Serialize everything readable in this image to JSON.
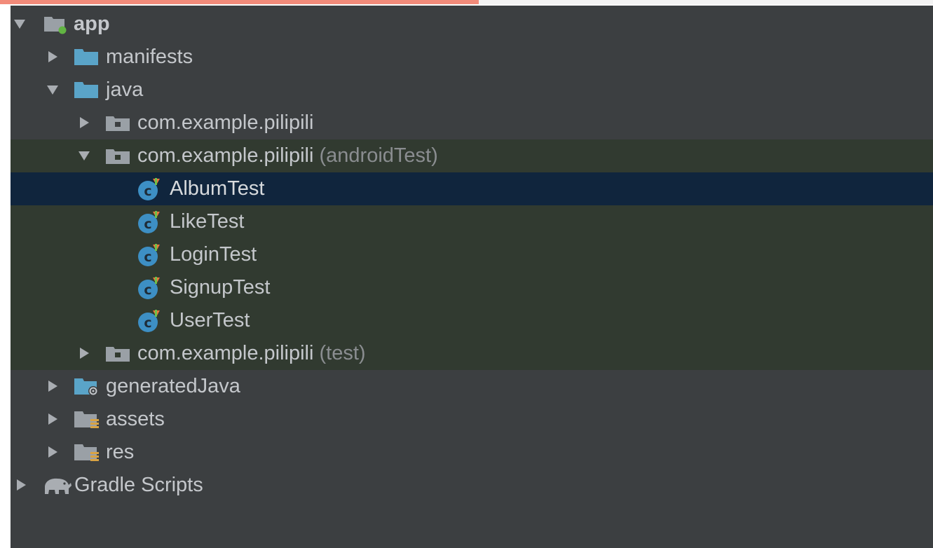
{
  "colors": {
    "panel_bg": "#3c3f41",
    "test_source_bg": "#313a30",
    "selection_bg": "#10253d",
    "text": "#c4c7cb",
    "secondary_text": "#8a8d90",
    "folder_blue": "#5aa4c8",
    "folder_gray": "#9aa0a6",
    "accent_orange": "#f28b7a"
  },
  "tree": {
    "app": {
      "label": "app",
      "icon": "module-folder-icon",
      "expanded": true
    },
    "manifests": {
      "label": "manifests",
      "icon": "folder-icon",
      "expanded": false
    },
    "java": {
      "label": "java",
      "icon": "folder-icon",
      "expanded": true
    },
    "pkg_main": {
      "label": "com.example.pilipili",
      "suffix": "",
      "icon": "package-icon",
      "expanded": false
    },
    "pkg_android_test": {
      "label": "com.example.pilipili",
      "suffix": "(androidTest)",
      "icon": "package-icon",
      "expanded": true
    },
    "classes": [
      {
        "label": "AlbumTest",
        "icon": "test-class-icon",
        "selected": true
      },
      {
        "label": "LikeTest",
        "icon": "test-class-icon",
        "selected": false
      },
      {
        "label": "LoginTest",
        "icon": "test-class-icon",
        "selected": false
      },
      {
        "label": "SignupTest",
        "icon": "test-class-icon",
        "selected": false
      },
      {
        "label": "UserTest",
        "icon": "test-class-icon",
        "selected": false
      }
    ],
    "pkg_test": {
      "label": "com.example.pilipili",
      "suffix": "(test)",
      "icon": "package-icon",
      "expanded": false
    },
    "generated_java": {
      "label": "generatedJava",
      "icon": "generated-folder-icon",
      "expanded": false
    },
    "assets": {
      "label": "assets",
      "icon": "resource-folder-icon",
      "expanded": false
    },
    "res": {
      "label": "res",
      "icon": "resource-folder-icon",
      "expanded": false
    },
    "gradle_scripts": {
      "label": "Gradle Scripts",
      "icon": "gradle-elephant-icon",
      "expanded": false
    }
  }
}
